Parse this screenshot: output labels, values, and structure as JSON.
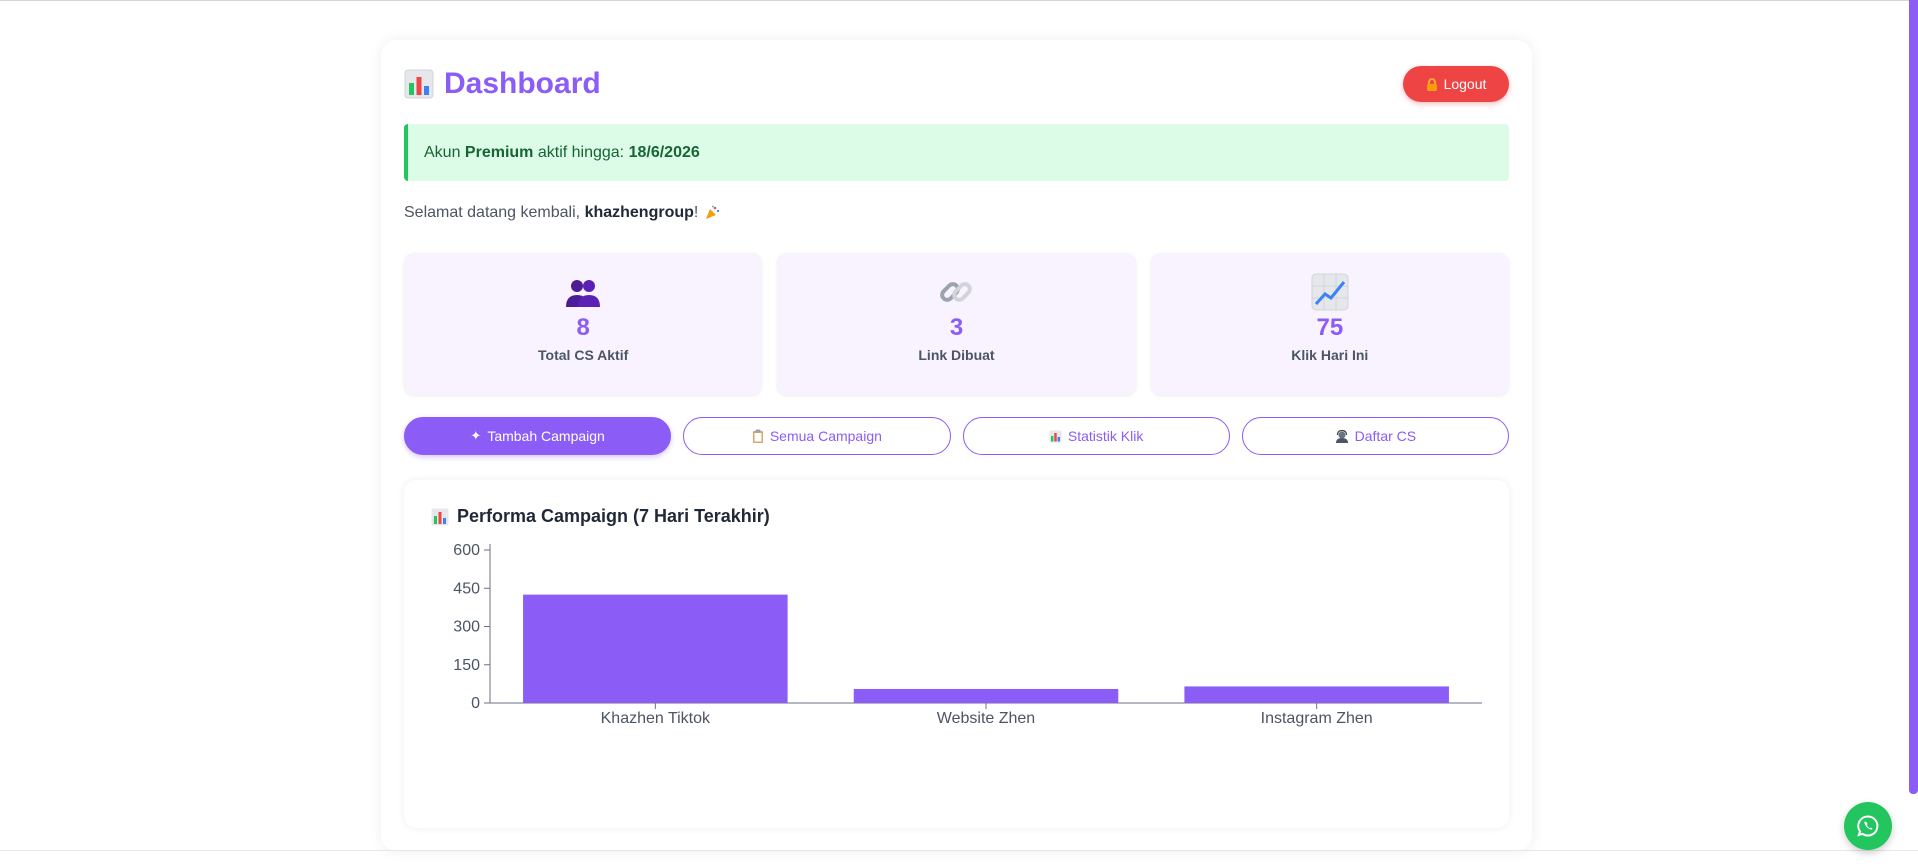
{
  "header": {
    "title_icon": "bar-chart-emoji-icon",
    "title": "Dashboard",
    "logout_label": "Logout"
  },
  "alert": {
    "prefix": "Akun",
    "plan": "Premium",
    "middle": "aktif hingga:",
    "expiry": "18/6/2026"
  },
  "welcome": {
    "prefix": "Selamat datang kembali,",
    "username": "khazhengroup",
    "suffix": "!"
  },
  "stats": [
    {
      "icon": "users-icon",
      "value": "8",
      "label": "Total CS Aktif"
    },
    {
      "icon": "link-icon",
      "value": "3",
      "label": "Link Dibuat"
    },
    {
      "icon": "chart-increasing-icon",
      "value": "75",
      "label": "Klik Hari Ini"
    }
  ],
  "tabs": [
    {
      "icon": "sparkle-icon",
      "label": "Tambah Campaign",
      "active": true
    },
    {
      "icon": "clipboard-icon",
      "label": "Semua Campaign",
      "active": false
    },
    {
      "icon": "bar-chart-icon",
      "label": "Statistik Klik",
      "active": false
    },
    {
      "icon": "support-icon",
      "label": "Daftar CS",
      "active": false
    }
  ],
  "chart_card": {
    "title": "Performa Campaign (7 Hari Terakhir)"
  },
  "colors": {
    "accent": "#8b5cf6",
    "danger": "#ef4444",
    "success": "#22c55e"
  },
  "chart_data": {
    "type": "bar",
    "categories": [
      "Khazhen Tiktok",
      "Website Zhen",
      "Instagram Zhen"
    ],
    "values": [
      425,
      55,
      65
    ],
    "yticks": [
      0,
      150,
      300,
      450,
      600
    ],
    "ylim": [
      0,
      600
    ],
    "grid": false,
    "legend": "none",
    "color": "#8b5cf6"
  }
}
